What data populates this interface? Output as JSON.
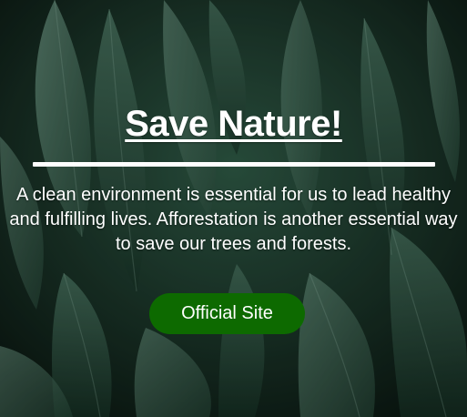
{
  "hero": {
    "title": "Save Nature!",
    "description": "A clean environment is essential for us to lead healthy and fulfilling lives. Afforestation is another essential way to save our trees and forests.",
    "button_label": "Official Site",
    "background_image": "plantain-leaves-photo"
  },
  "colors": {
    "text": "#ffffff",
    "button": "#0d6a00",
    "background_base": "#0e1f17"
  }
}
